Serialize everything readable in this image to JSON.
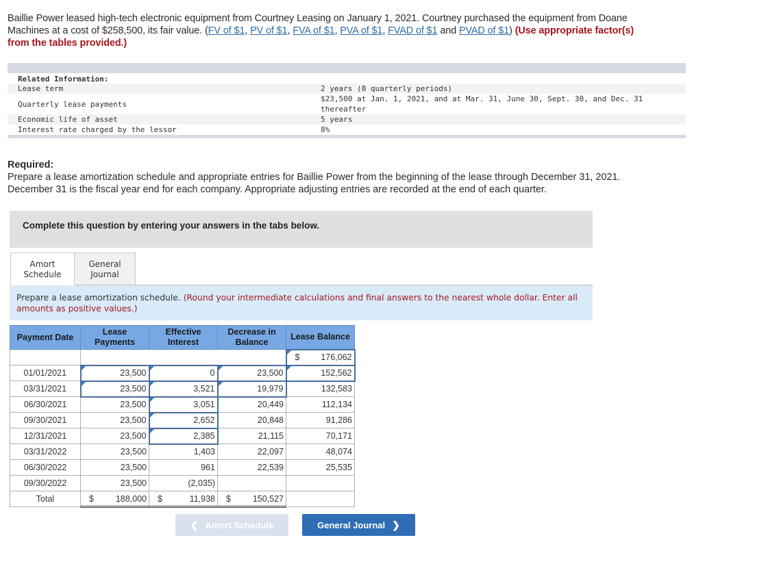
{
  "intro": {
    "text_1": "Baillie Power leased high-tech electronic equipment from Courtney Leasing on January 1, 2021. Courtney purchased the equipment from Doane Machines at a cost of $258,500, its fair value. (",
    "links": [
      "FV of $1",
      "PV of $1",
      "FVA of $1",
      "PVA of $1",
      "FVAD of $1",
      "PVAD of $1"
    ],
    "sep_comma": ", ",
    "sep_and": " and ",
    "close_paren": ") ",
    "instruction": "(Use appropriate factor(s) from the tables provided.)"
  },
  "related_info": {
    "title": "Related Information:",
    "rows": [
      {
        "label": "Lease term",
        "value": "2 years (8 quarterly periods)"
      },
      {
        "label": "Quarterly lease payments",
        "value": "$23,500 at Jan. 1, 2021, and at Mar. 31, June 30, Sept. 30, and Dec. 31 thereafter"
      },
      {
        "label": "Economic life of asset",
        "value": "5 years"
      },
      {
        "label": "Interest rate charged by the lessor",
        "value": "8%"
      }
    ]
  },
  "required": {
    "heading": "Required:",
    "text": "Prepare a lease amortization schedule and appropriate entries for Baillie Power from the beginning of the lease through December 31, 2021. December 31 is the fiscal year end for each company. Appropriate adjusting entries are recorded at the end of each quarter."
  },
  "complete_box": "Complete this question by entering your answers in the tabs below.",
  "tabs": [
    {
      "label": "Amort Schedule",
      "active": true
    },
    {
      "label": "General Journal",
      "active": false
    }
  ],
  "instructions": {
    "main": "Prepare a lease amortization schedule. ",
    "note": "(Round your intermediate calculations and final answers to the nearest whole dollar. Enter all amounts as positive values.)"
  },
  "table": {
    "headers": [
      "Payment Date",
      "Lease Payments",
      "Effective Interest",
      "Decrease in Balance",
      "Lease Balance"
    ],
    "opening": {
      "currency": "$",
      "balance": "176,062"
    },
    "rows": [
      {
        "date": "01/01/2021",
        "payment": "23,500",
        "interest": "0",
        "decrease": "23,500",
        "balance": "152,562"
      },
      {
        "date": "03/31/2021",
        "payment": "23,500",
        "interest": "3,521",
        "decrease": "19,979",
        "balance": "132,583"
      },
      {
        "date": "06/30/2021",
        "payment": "23,500",
        "interest": "3,051",
        "decrease": "20,449",
        "balance": "112,134"
      },
      {
        "date": "09/30/2021",
        "payment": "23,500",
        "interest": "2,652",
        "decrease": "20,848",
        "balance": "91,286"
      },
      {
        "date": "12/31/2021",
        "payment": "23,500",
        "interest": "2,385",
        "decrease": "21,115",
        "balance": "70,171"
      },
      {
        "date": "03/31/2022",
        "payment": "23,500",
        "interest": "1,403",
        "decrease": "22,097",
        "balance": "48,074"
      },
      {
        "date": "06/30/2022",
        "payment": "23,500",
        "interest": "961",
        "decrease": "22,539",
        "balance": "25,535"
      },
      {
        "date": "09/30/2022",
        "payment": "23,500",
        "interest": "(2,035)",
        "decrease": "",
        "balance": ""
      }
    ],
    "total": {
      "label": "Total",
      "currency": "$",
      "payment": "188,000",
      "interest": "11,938",
      "decrease": "150,527"
    }
  },
  "nav": {
    "prev_label": "Amort Schedule",
    "next_label": "General Journal",
    "prev_icon": "chevron-left-icon",
    "next_icon": "chevron-right-icon"
  },
  "colors": {
    "header_blue": "#77a8e4",
    "instruction_bg": "#d9ebf8",
    "accent_red": "#a4171f",
    "button_blue": "#2f6db5"
  }
}
